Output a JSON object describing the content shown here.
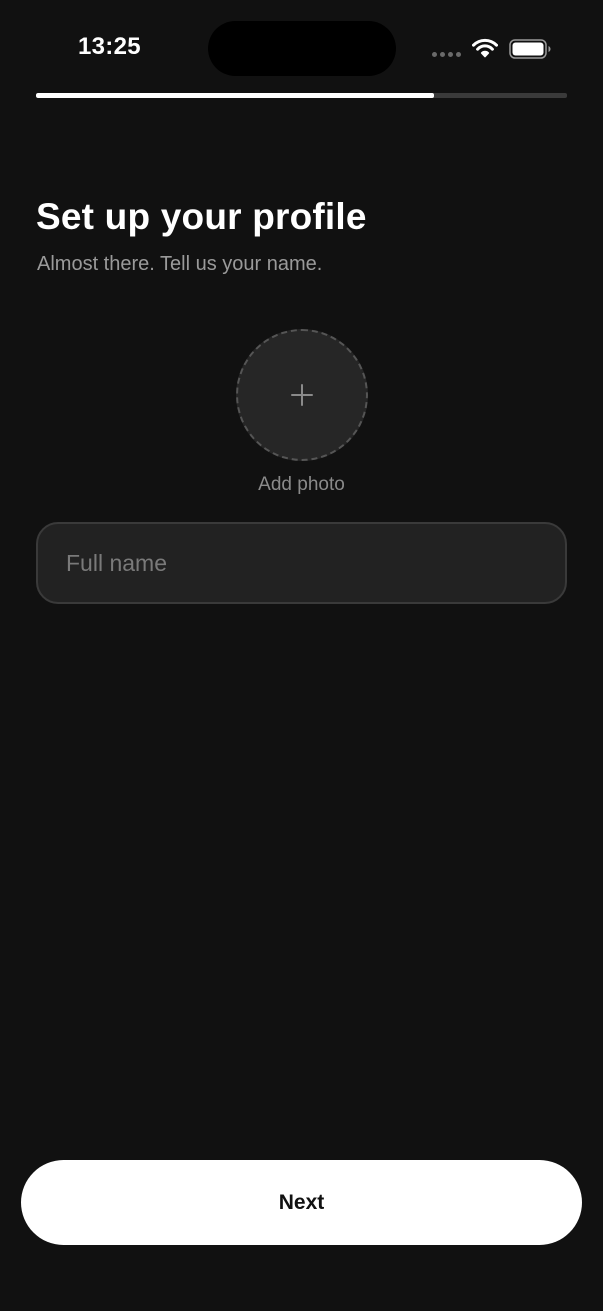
{
  "status_bar": {
    "time": "13:25",
    "icons": [
      "signal-dots-icon",
      "wifi-icon",
      "battery-icon"
    ]
  },
  "progress": {
    "fraction": 0.75
  },
  "header": {
    "title": "Set up your profile",
    "subtitle": "Almost there. Tell us your name."
  },
  "avatar": {
    "icon": "plus-icon",
    "label": "Add photo"
  },
  "form": {
    "full_name": {
      "value": "",
      "placeholder": "Full name"
    }
  },
  "footer": {
    "next_label": "Next"
  },
  "colors": {
    "background": "#111111",
    "primary_text": "#ffffff",
    "secondary_text": "#9a9a9a",
    "input_background": "#222222",
    "button_background": "#ffffff",
    "button_text": "#111111"
  }
}
